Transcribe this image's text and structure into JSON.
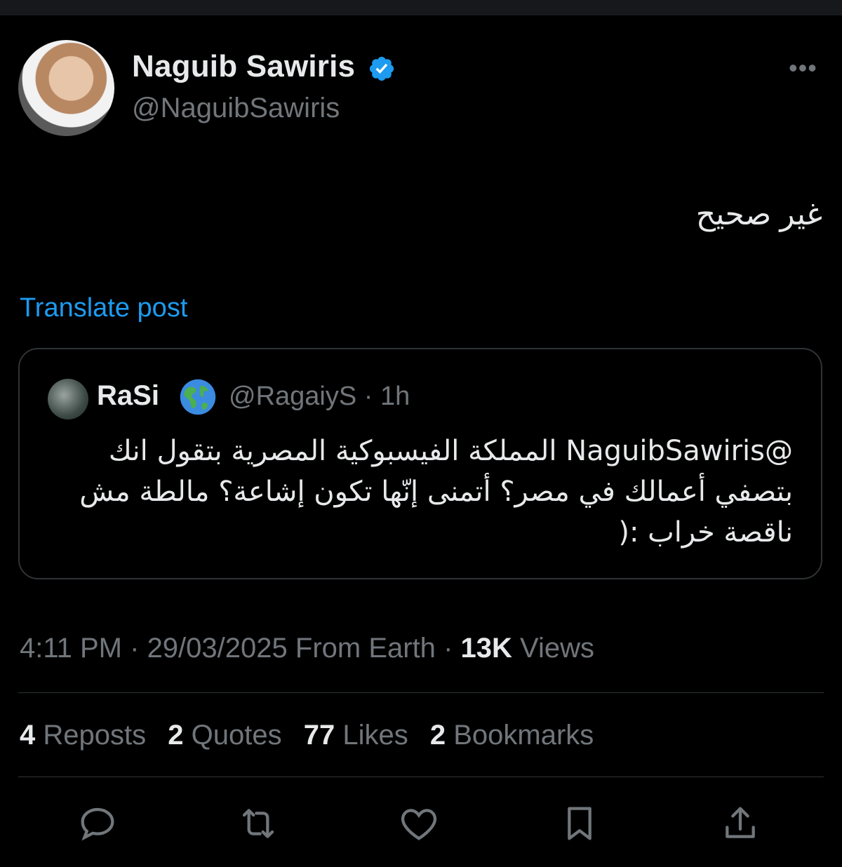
{
  "author": {
    "name": "Naguib Sawiris",
    "handle": "@NaguibSawiris"
  },
  "tweet": {
    "text": "غير صحيح",
    "translate_label": "Translate post"
  },
  "quoted": {
    "name": "RaSi",
    "emoji": "🌎",
    "handle": "@RagaiyS",
    "separator": "·",
    "time": "1h",
    "text": "@NaguibSawiris المملكة الفيسبوكية المصرية بتقول انك بتصفي أعمالك في مصر؟ أتمنى إنّها تكون إشاعة؟ مالطة مش ناقصة خراب :("
  },
  "meta": {
    "time": "4:11 PM",
    "date": "29/03/2025",
    "source": "From Earth",
    "views_count": "13K",
    "views_label": "Views"
  },
  "stats": [
    {
      "count": "4",
      "label": "Reposts"
    },
    {
      "count": "2",
      "label": "Quotes"
    },
    {
      "count": "77",
      "label": "Likes"
    },
    {
      "count": "2",
      "label": "Bookmarks"
    }
  ],
  "colors": {
    "background": "#000000",
    "text": "#e7e9ea",
    "secondary": "#71767b",
    "accent": "#1d9bf0",
    "border": "#2f3336"
  },
  "icons": [
    "verified-badge-icon",
    "more-icon",
    "reply-icon",
    "repost-icon",
    "like-icon",
    "bookmark-icon",
    "share-icon"
  ]
}
